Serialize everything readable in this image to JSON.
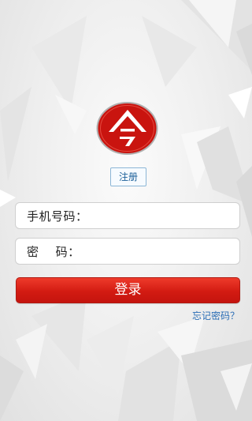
{
  "register": {
    "label": "注册"
  },
  "phone": {
    "label": "手机号码：",
    "value": ""
  },
  "password": {
    "label": "密    码：",
    "value": ""
  },
  "login": {
    "label": "登录"
  },
  "forgot": {
    "label": "忘记密码？"
  },
  "colors": {
    "brand_red": "#d31b12",
    "link_blue": "#2a6db5",
    "register_border": "#8cb6d6"
  },
  "icons": {
    "logo": "ling-logo",
    "background": "faceted-polygon-pattern"
  }
}
